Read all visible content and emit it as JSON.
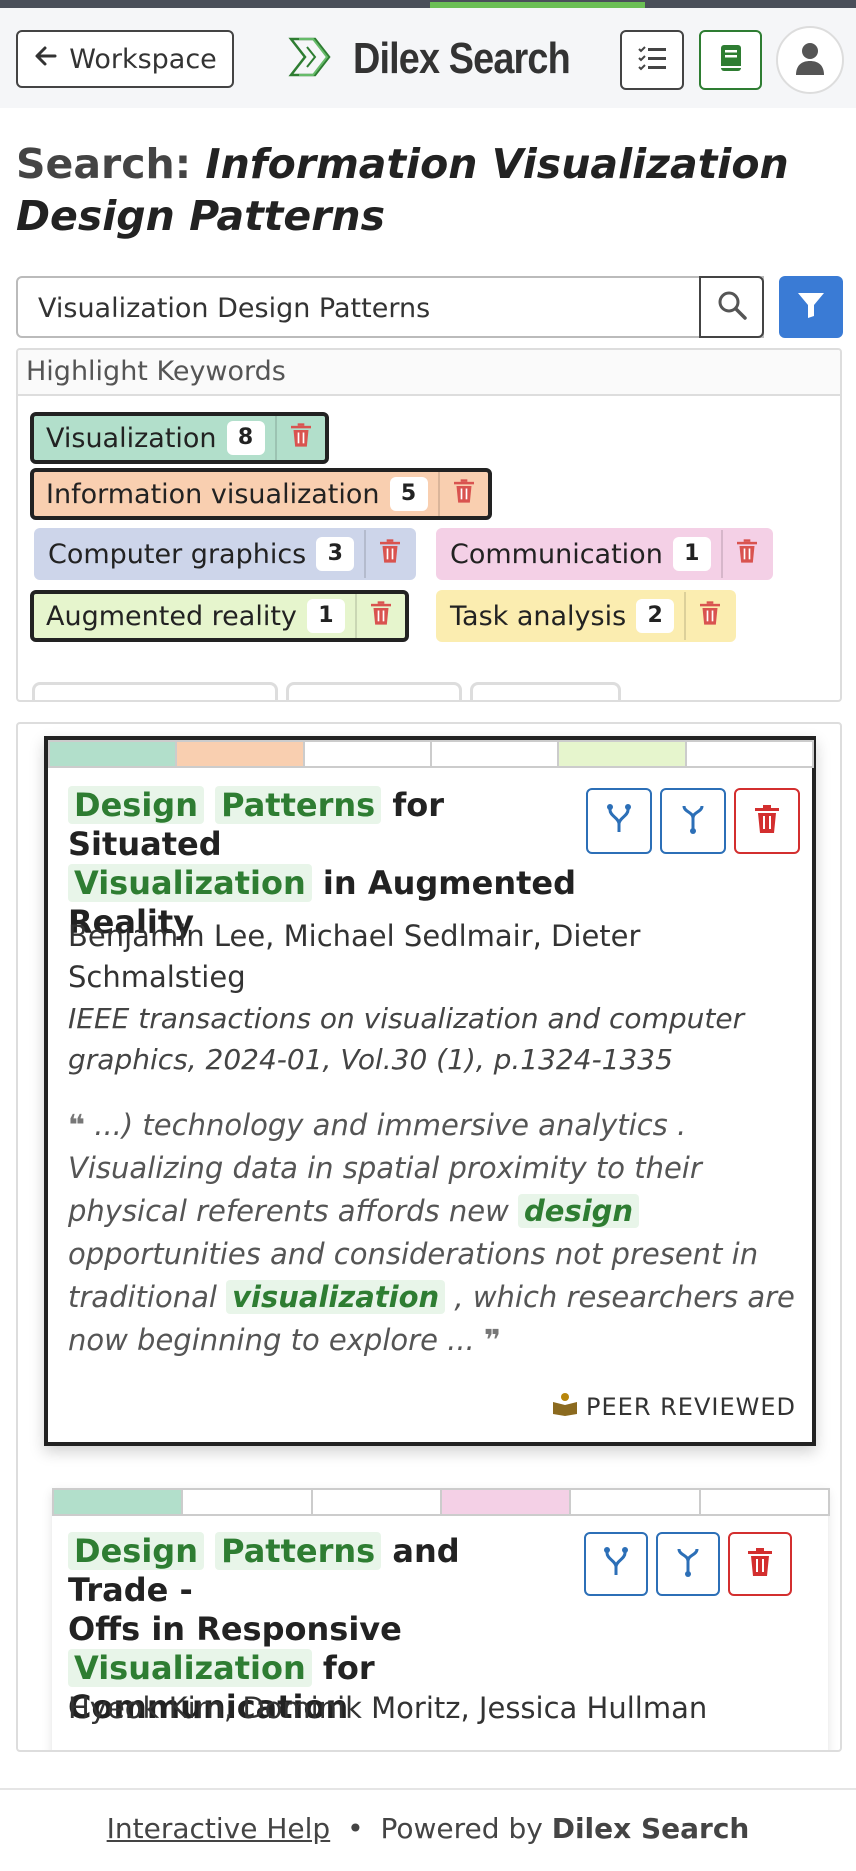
{
  "nav": {
    "workspace_label": "Workspace",
    "app_name": "Dilex Search"
  },
  "page": {
    "title_prefix": "Search:",
    "title_query": "Information Visualization Design Patterns"
  },
  "search": {
    "value": "Visualization Design Patterns"
  },
  "keywords_panel": {
    "header": "Highlight Keywords",
    "chips": [
      {
        "label": "Visualization",
        "count": "8",
        "color": "#b2dfcb",
        "emphasized": true
      },
      {
        "label": "Information visualization",
        "count": "5",
        "color": "#f9cfb0",
        "emphasized": true
      },
      {
        "label": "Computer graphics",
        "count": "3",
        "color": "#cdd5ea",
        "emphasized": false
      },
      {
        "label": "Communication",
        "count": "1",
        "color": "#f4d0e6",
        "emphasized": false
      },
      {
        "label": "Augmented reality",
        "count": "1",
        "color": "#e6f5cd",
        "emphasized": true
      },
      {
        "label": "Task analysis",
        "count": "2",
        "color": "#fbedb0",
        "emphasized": false
      }
    ]
  },
  "results": [
    {
      "title_parts": [
        "Design",
        "Patterns",
        "for Situated",
        "Visualization",
        "in Augmented",
        "Reality"
      ],
      "authors": "Benjamin Lee, Michael Sedlmair, Dieter Schmalstieg",
      "journal": "IEEE transactions on visualization and computer graphics, 2024-01, Vol.30 (1), p.1324-1335",
      "snippet_parts": [
        "...) technology and immersive analytics . Visualizing data in spatial proximity to their physical referents affords new",
        "design",
        "opportunities and considerations not present in traditional",
        "visualization",
        ", which researchers are now beginning to explore ..."
      ],
      "badge": "PEER REVIEWED",
      "strip_colors": [
        "#b2dfcb",
        "#f9cfb0",
        "#ffffff",
        "#ffffff",
        "#e6f5cd",
        "#ffffff"
      ]
    },
    {
      "title_parts": [
        "Design",
        "Patterns",
        "and Trade -",
        "Offs in Responsive",
        "Visualization",
        "for",
        "Communication"
      ],
      "authors": "Hyeok Kim, Dominik Moritz, Jessica Hullman",
      "strip_colors": [
        "#b2dfcb",
        "#ffffff",
        "#ffffff",
        "#f4d0e6",
        "#ffffff",
        "#ffffff"
      ]
    }
  ],
  "footer": {
    "help": "Interactive Help",
    "separator": "•",
    "powered": "Powered by",
    "brand": "Dilex Search"
  }
}
